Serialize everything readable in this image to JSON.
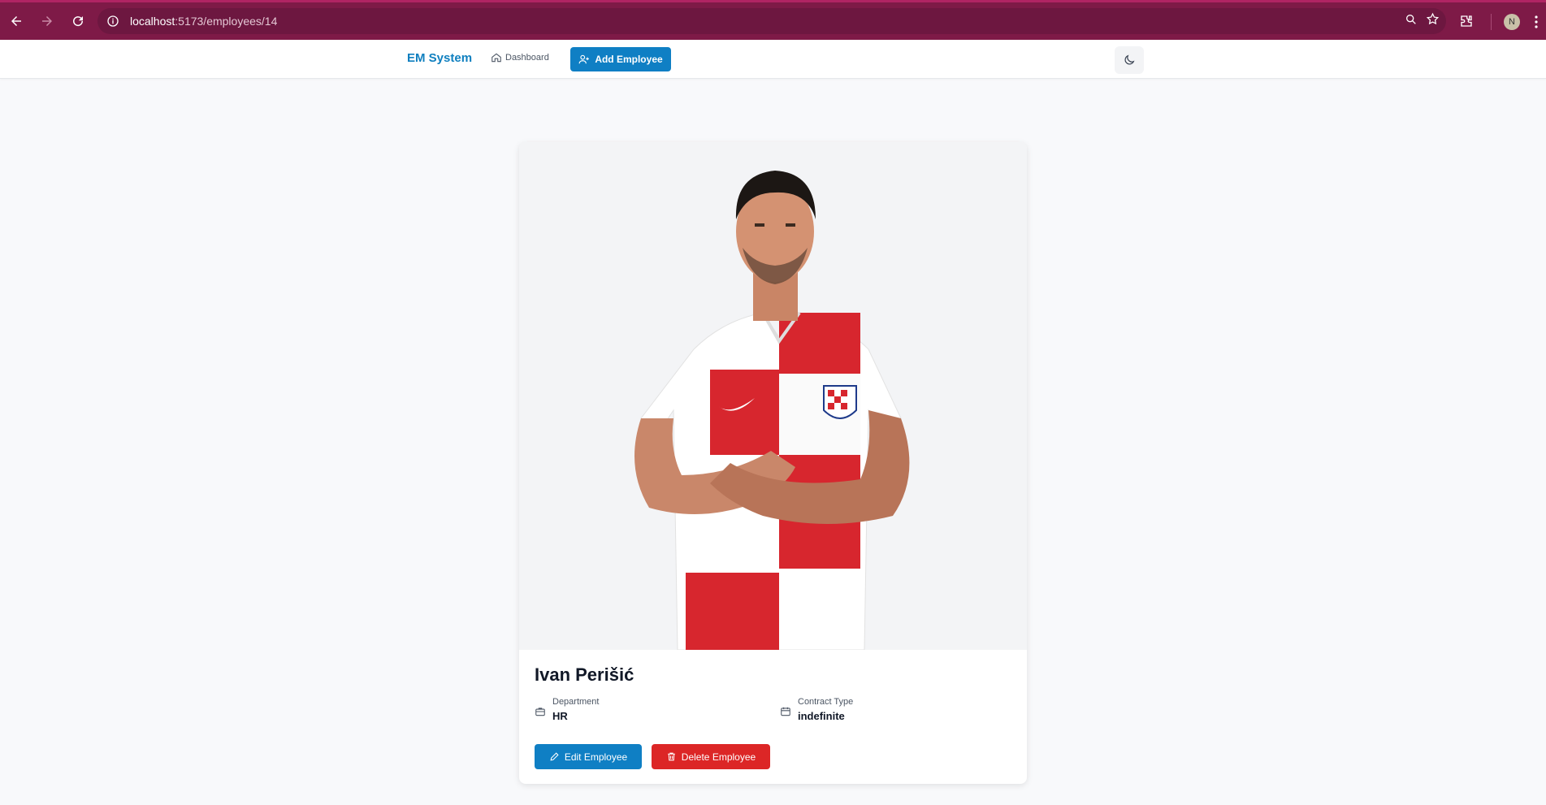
{
  "browser": {
    "url_host": "localhost",
    "url_path": ":5173/employees/14",
    "profile_initial": "N"
  },
  "navbar": {
    "brand": "EM System",
    "dashboard_label": "Dashboard",
    "add_employee_label": "Add Employee"
  },
  "employee": {
    "name": "Ivan Perišić",
    "department_label": "Department",
    "department_value": "HR",
    "contract_label": "Contract Type",
    "contract_value": "indefinite",
    "photo_alt": "Ivan Perišić"
  },
  "actions": {
    "edit_label": "Edit Employee",
    "delete_label": "Delete Employee"
  },
  "colors": {
    "browser_frame": "#7e1a47",
    "brand_blue": "#0f7fc4",
    "danger_red": "#dc2626"
  }
}
